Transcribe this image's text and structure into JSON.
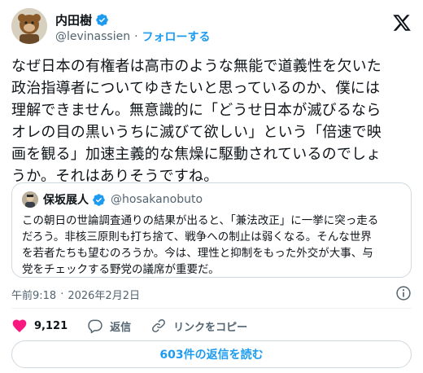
{
  "author": {
    "name": "内田樹",
    "handle": "@levinassien",
    "separator": "·",
    "follow_label": "フォローする"
  },
  "tweet": {
    "lines": [
      "なぜ日本の有権者は高市のような無能で道義性を欠いた",
      "政治指導者についてゆきたいと思っているのか、僕には",
      "理解できません。無意識的に「どうせ日本が滅びるなら",
      "オレの目の黒いうちに滅びて欲しい」という「倍速で映",
      "画を観る」加速主義的な焦燥に駆動されているのでしょ",
      "うか。それはありそうですね。"
    ]
  },
  "quote": {
    "name": "保坂展人",
    "handle": "@hosakanobuto",
    "lines": [
      "この朝日の世論調査通りの結果が出ると、「兼法改正」に一挙に突っ走る",
      "だろう。非核三原則も打ち捨て、戦争への制止は弱くなる。そんな世界",
      "を若者たちも望むのろうか。今は、理性と抑制をもった外交が大事、与",
      "党をチェックする野党の議席が重要だ。"
    ]
  },
  "timestamp": {
    "time": "午前9:18",
    "separator": "·",
    "date": "2026年2月2日"
  },
  "actions": {
    "like_count": "9,121",
    "reply_label": "返信",
    "copy_link_label": "リンクをコピー"
  },
  "read_replies_label": "603件の返信を読む",
  "colors": {
    "accent": "#1d9bf0",
    "like": "#f91880",
    "secondary_text": "#536471"
  }
}
